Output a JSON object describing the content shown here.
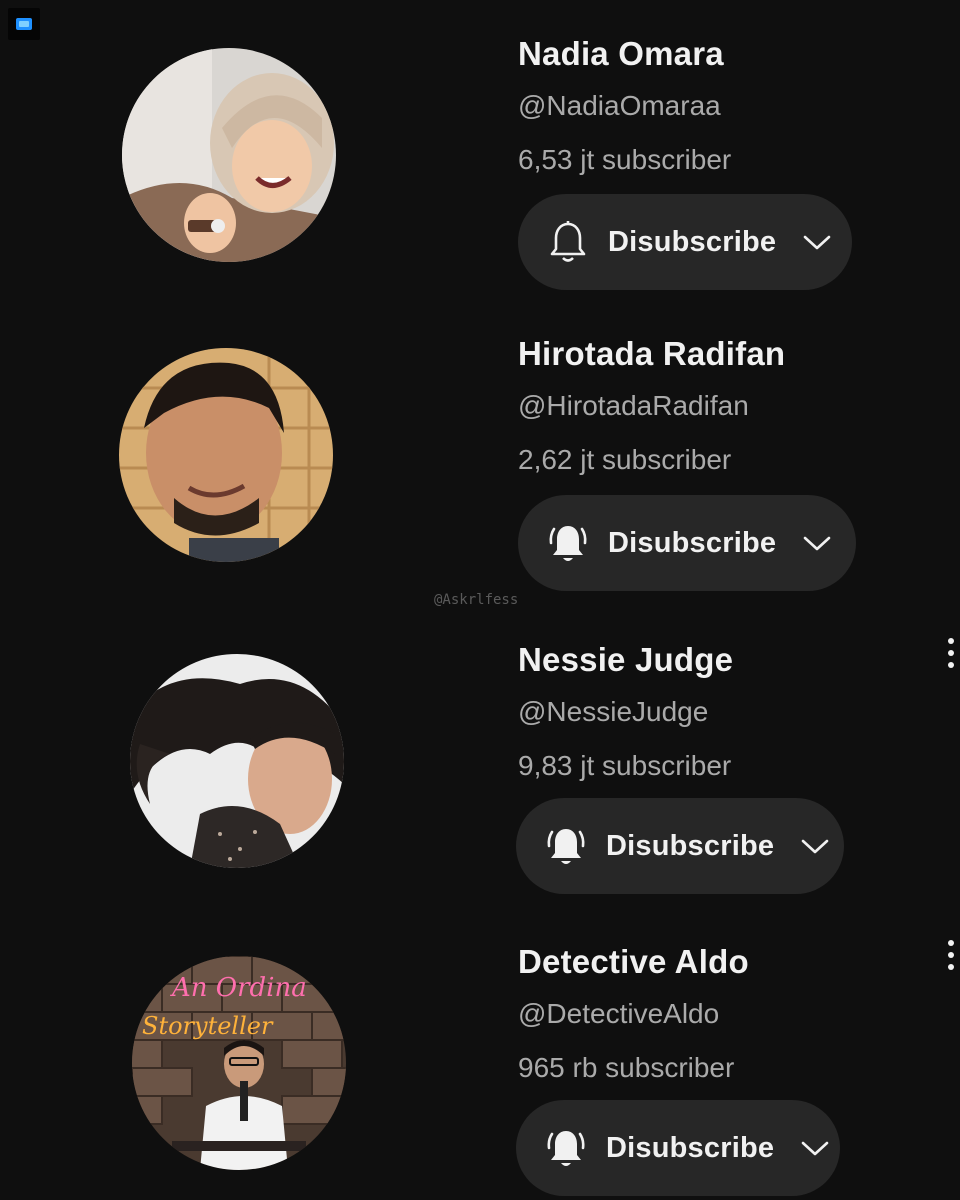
{
  "watermark": "@Askrlfess",
  "icons": {
    "corner": "app-icon",
    "bell_outline": "bell-outline-icon",
    "bell_all": "bell-ringing-icon",
    "chevron": "chevron-down-icon",
    "more": "more-vert-icon"
  },
  "colors": {
    "background": "#0f0f0f",
    "button": "#272727",
    "secondary_text": "#aaaaaa"
  },
  "channels": [
    {
      "name": "Nadia Omara",
      "handle": "@NadiaOmaraa",
      "subscribers": "6,53 jt subscriber",
      "button_label": "Disubscribe",
      "notification": "bell-outline"
    },
    {
      "name": "Hirotada Radifan",
      "handle": "@HirotadaRadifan",
      "subscribers": "2,62 jt subscriber",
      "button_label": "Disubscribe",
      "notification": "bell-ringing"
    },
    {
      "name": "Nessie Judge",
      "handle": "@NessieJudge",
      "subscribers": "9,83 jt subscriber",
      "button_label": "Disubscribe",
      "notification": "bell-ringing"
    },
    {
      "name": "Detective Aldo",
      "handle": "@DetectiveAldo",
      "subscribers": "965 rb subscriber",
      "button_label": "Disubscribe",
      "notification": "bell-ringing"
    }
  ],
  "avatar_images": [
    {
      "sign_text": ""
    },
    {
      "sign_text": ""
    },
    {
      "sign_text": ""
    },
    {
      "sign_line1": "An Ordina",
      "sign_line2": "Storyteller"
    }
  ]
}
